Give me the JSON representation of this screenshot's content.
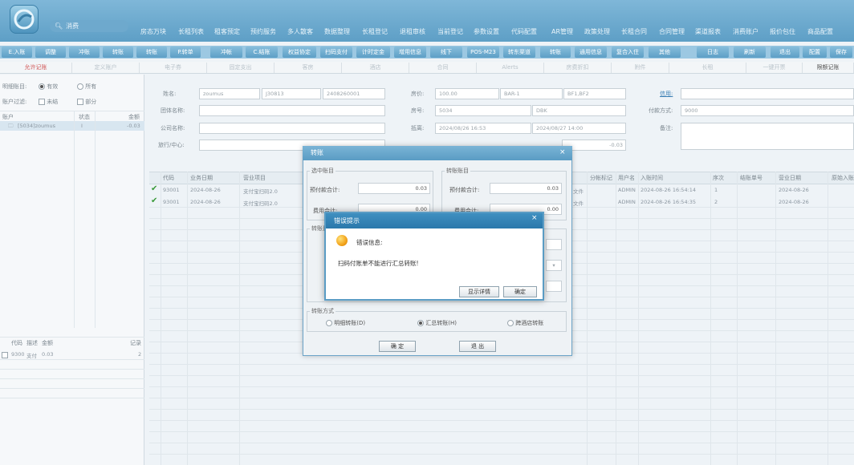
{
  "header": {
    "search_placeholder": "消费",
    "menu": [
      "房态万块",
      "长租列表",
      "租客预定",
      "预约服务",
      "多人散客",
      "数据整理",
      "长租登记",
      "退租审核",
      "当前登记",
      "参数设置",
      "代码配置",
      "AR管理",
      "政策处理",
      "长租合同",
      "合同管理",
      "渠道报表",
      "消费账户",
      "报价包住",
      "商品配置"
    ]
  },
  "toolbar": {
    "buttons": [
      "E.入账",
      "调整",
      "冲账",
      "转账",
      "转账",
      "P.转单",
      "冲帐",
      "C.结账",
      "权益协定",
      "扫码支付",
      "计时定金",
      "增用信息",
      "线下",
      "POS-M23",
      "转东渠道",
      "转账",
      "通用信息",
      "复合入住",
      "其他",
      "日志",
      "刷新",
      "退出",
      "配置",
      "保存"
    ]
  },
  "tabs": [
    "允许记账",
    "定义账户",
    "电子券",
    "固定支出",
    "客房",
    "酒店",
    "合同",
    "Alerts",
    "房费折扣",
    "附件",
    "长租",
    "一键开票",
    "限额记账"
  ],
  "left": {
    "filter_label": "明细账目:",
    "filter_valid": "有效",
    "filter_all": "所有",
    "account_filter_label": "账户过滤:",
    "account_unsettled": "未结",
    "account_partial": "部分",
    "col_account": "账户",
    "col_status": "状态",
    "col_amount": "金额",
    "row_account": "[5034]zoumus",
    "row_status": "I",
    "row_amount": "-0.03",
    "bottom_cols": [
      "代码",
      "描述",
      "金额"
    ],
    "bottom_col_records": "记录",
    "bottom_row": [
      "9300",
      "支付",
      "0.03"
    ],
    "bottom_row_count": "2"
  },
  "form": {
    "name_label": "姓名:",
    "name_value": "zoumus",
    "id_value": "J30813",
    "booking_value": "2408260001",
    "group_label": "团体名称:",
    "company_label": "公司名称:",
    "agency_label": "旅行/中心:",
    "rate_label": "房价:",
    "rate_value": "100.00",
    "rate_code": "BAR-1",
    "package": "BF1,BF2",
    "room_label": "房号:",
    "room_value": "5034",
    "room_type": "DBK",
    "stay_label": "抵离:",
    "arrival": "2024/08/26 16:53",
    "departure": "2024/08/27 14:00",
    "balance_value": "-0.03",
    "credit_label": "信用:",
    "pay_label": "付款方式:",
    "pay_value": "9000",
    "remark_label": "备注:"
  },
  "table": {
    "headers": [
      "代码",
      "业务日期",
      "营业项目",
      "分帐标记",
      "用户名",
      "入账时间",
      "序次",
      "结账单号",
      "营业日期",
      "原始入账"
    ],
    "rows": [
      {
        "code": "93001",
        "date": "2024-08-26",
        "item": "支付宝扫码2.0",
        "flag": "文件",
        "user": "ADMIN",
        "time": "2024-08-26 16:54:14",
        "seq": "1",
        "bizdate": "2024-08-26"
      },
      {
        "code": "93001",
        "date": "2024-08-26",
        "item": "支付宝扫码2.0",
        "flag": "文件",
        "user": "ADMIN",
        "time": "2024-08-26 16:54:35",
        "seq": "2",
        "bizdate": "2024-08-26"
      }
    ]
  },
  "transfer_dialog": {
    "title": "转账",
    "selected_group": "选中账目",
    "target_group": "转账账目",
    "prepay_label": "预付款合计:",
    "prepay_value": "0.03",
    "target_prepay_value": "0.03",
    "charge_label": "费用合计:",
    "charge_value": "0.00",
    "target_charge_value": "0.00",
    "transfer_target_group": "转账目",
    "mode_group": "转账方式",
    "mode_detail": "明细转账(D)",
    "mode_summary": "汇总转账(H)",
    "mode_cross": "跨酒店转账",
    "ok_label": "确 定",
    "exit_label": "退 出"
  },
  "error_dialog": {
    "title": "错误提示",
    "heading": "错误信息:",
    "message": "扫码付账单不能进行汇总转账!",
    "details_label": "显示详情",
    "ok_label": "确定"
  },
  "colors": {
    "header": "#6aa8cf",
    "dialog_title": "#2a78ab",
    "accent_red": "#d25a5a"
  }
}
